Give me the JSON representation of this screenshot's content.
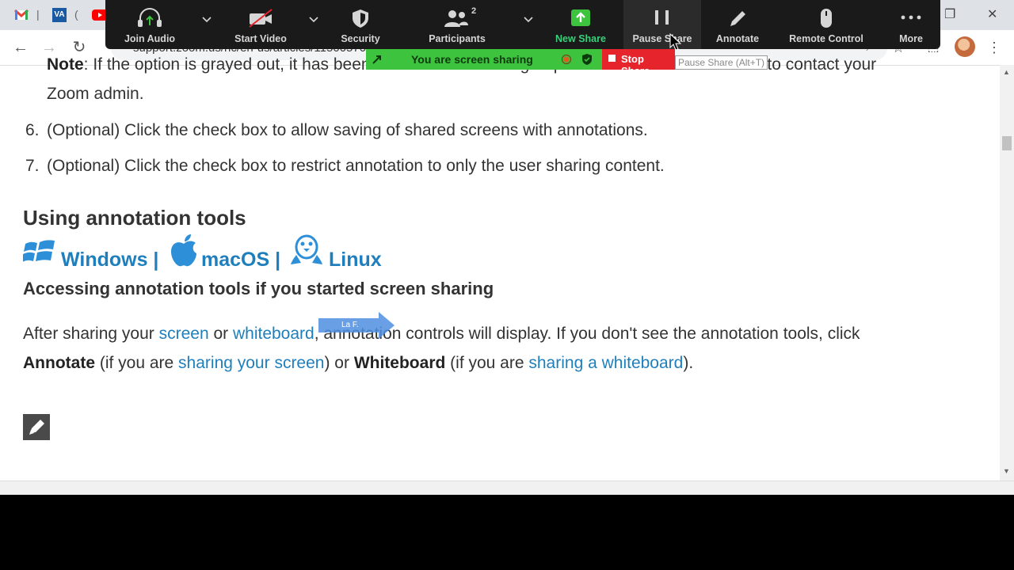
{
  "browser": {
    "url": "support.zoom.us/hc/en-us/articles/115005706806",
    "tabs": [
      {
        "icon": "gmail-icon"
      },
      {
        "label": "VA",
        "icon": "va-icon"
      },
      {
        "icon": "youtube-icon"
      }
    ]
  },
  "zoom_toolbar": {
    "buttons": [
      {
        "label": "Join Audio",
        "icon": "headphones-icon"
      },
      {
        "label": "Start Video",
        "icon": "video-off-icon"
      },
      {
        "label": "Security",
        "icon": "shield-icon"
      },
      {
        "label": "Participants",
        "icon": "participants-icon",
        "count": "2"
      },
      {
        "label": "New Share",
        "icon": "share-up-icon"
      },
      {
        "label": "Pause Share",
        "icon": "pause-icon"
      },
      {
        "label": "Annotate",
        "icon": "pencil-icon"
      },
      {
        "label": "Remote Control",
        "icon": "mouse-icon"
      },
      {
        "label": "More",
        "icon": "more-dots-icon"
      }
    ],
    "sharing_banner": "You are screen sharing",
    "stop_share": "Stop Share",
    "tooltip": "Pause Share (Alt+T)"
  },
  "article": {
    "note_line1_start": "Note",
    "note_line1_rest": ": If the option is grayed out, it has been locked at either the group or account level. You need to contact your",
    "note_line2": "Zoom admin.",
    "step6_num": "6.",
    "step6_text": "(Optional) Click the check box to allow saving of shared screens with annotations.",
    "step7_num": "7.",
    "step7_text": "(Optional) Click the check box to restrict annotation to only the user sharing content.",
    "heading_using": "Using annotation tools",
    "os_windows": "Windows |",
    "os_macos": "macOS |",
    "os_linux": "Linux",
    "heading_accessing": "Accessing annotation tools if you started screen sharing",
    "para": {
      "t1": "After sharing your ",
      "link_screen": "screen",
      "t2": " or ",
      "link_whiteboard": "whiteboard",
      "t3": ", annotation controls will display. If you don't see the annotation tools, click",
      "b_annotate": "Annotate",
      "t4": " (if you are ",
      "link_sharing_screen": "sharing your screen",
      "t5": ") or ",
      "b_whiteboard": "Whiteboard",
      "t6": " (if you are ",
      "link_sharing_whiteboard": "sharing a whiteboard",
      "t7": ")."
    },
    "arrow_label": "La F."
  },
  "colors": {
    "link": "#1f7fbd",
    "zoom_bar": "#1a1a1a",
    "share_green": "#3ec33e",
    "stop_red": "#e5242b"
  }
}
